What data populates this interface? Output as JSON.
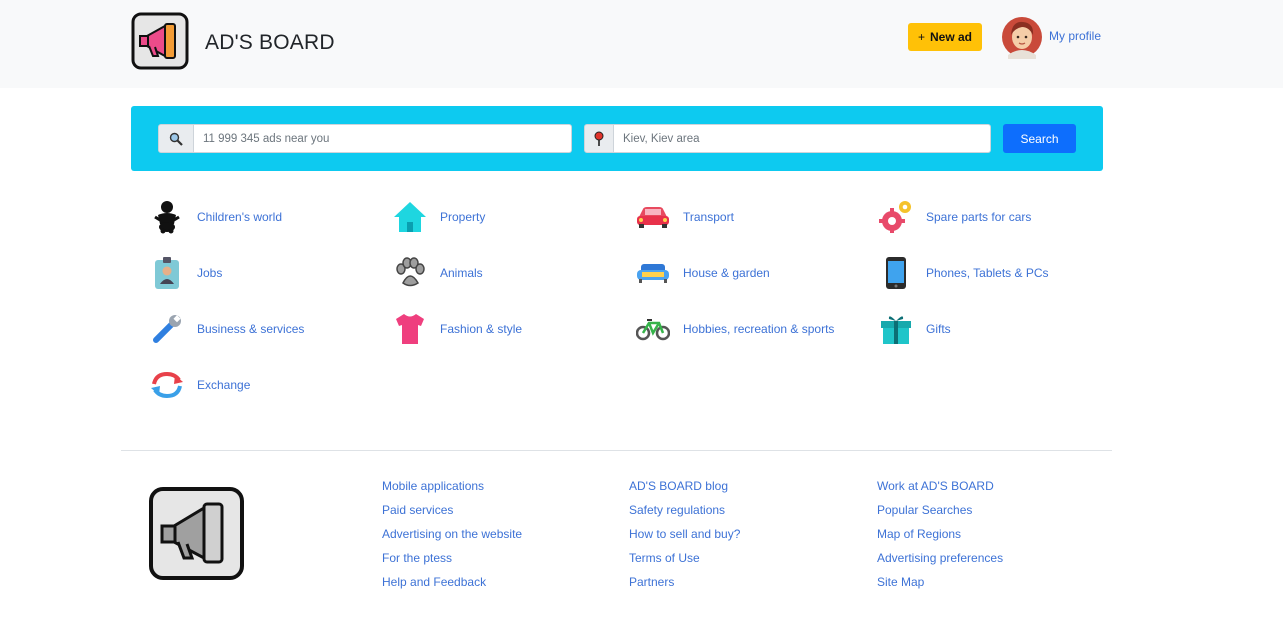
{
  "header": {
    "brand": "AD'S BOARD",
    "new_ad_plus": "+",
    "new_ad_label": "New ad",
    "profile_label": "My profile"
  },
  "search": {
    "query_placeholder": "11 999 345 ads near you",
    "location_placeholder": "Kiev, Kiev area",
    "button_label": "Search"
  },
  "categories": [
    {
      "label": "Children's world",
      "icon": "baby-icon"
    },
    {
      "label": "Property",
      "icon": "house-icon"
    },
    {
      "label": "Transport",
      "icon": "car-icon"
    },
    {
      "label": "Spare parts for cars",
      "icon": "gear-icon"
    },
    {
      "label": "Jobs",
      "icon": "badge-icon"
    },
    {
      "label": "Animals",
      "icon": "paw-icon"
    },
    {
      "label": "House & garden",
      "icon": "sofa-icon"
    },
    {
      "label": "Phones, Tablets & PCs",
      "icon": "phone-icon"
    },
    {
      "label": "Business & services",
      "icon": "wrench-icon"
    },
    {
      "label": "Fashion & style",
      "icon": "tshirt-icon"
    },
    {
      "label": "Hobbies, recreation & sports",
      "icon": "bicycle-icon"
    },
    {
      "label": "Gifts",
      "icon": "gift-icon"
    },
    {
      "label": "Exchange",
      "icon": "exchange-icon"
    }
  ],
  "footer": {
    "col1": [
      "Mobile applications",
      "Paid services",
      "Advertising on the website",
      "For the ptess",
      "Help and Feedback"
    ],
    "col2": [
      "AD'S BOARD blog",
      "Safety regulations",
      "How to sell and buy?",
      "Terms of Use",
      "Partners"
    ],
    "col3": [
      "Work at AD'S BOARD",
      "Popular Searches",
      "Map of Regions",
      "Advertising preferences",
      "Site Map"
    ]
  },
  "colors": {
    "header_bg": "#f8f9fa",
    "search_panel": "#0dcaf0",
    "new_ad": "#ffc107",
    "search_button": "#0d6efd",
    "link": "#3d72d6"
  }
}
